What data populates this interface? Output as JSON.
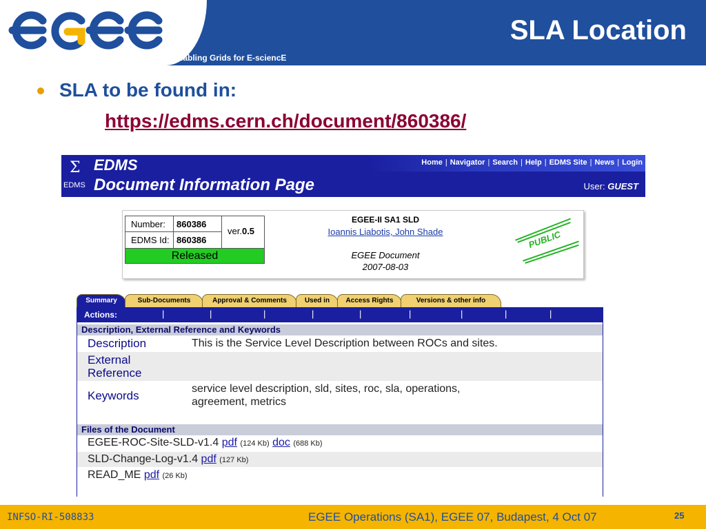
{
  "slide": {
    "tagline": "Enabling Grids for E-sciencE",
    "title": "SLA Location",
    "bullet_text": "SLA to be found in:",
    "bullet_link": "https://edms.cern.ch/document/860386/"
  },
  "edms": {
    "sigma": "Σ",
    "small_label": "EDMS",
    "title": "EDMS",
    "page_title": "Document Information Page",
    "nav": [
      "Home",
      "Navigator",
      "Search",
      "Help",
      "EDMS Site",
      "News",
      "Login"
    ],
    "nav_sep": "|",
    "user_label": "User:",
    "user_name": "GUEST",
    "number_label": "Number:",
    "number_value": "860386",
    "edmsid_label": "EDMS Id:",
    "edmsid_value": "860386",
    "ver_label": "ver.",
    "ver_value": "0.5",
    "status": "Released",
    "doc_title": "EGEE-II SA1 SLD",
    "doc_authors": "Ioannis Liabotis, John Shade",
    "doc_type": "EGEE Document",
    "doc_date": "2007-08-03",
    "stamp": "PUBLIC",
    "tabs": [
      "Summary",
      "Sub-Documents",
      "Approval & Comments",
      "Used in",
      "Access Rights",
      "Versions & other info"
    ],
    "actions_label": "Actions:",
    "section_desc": "Description, External Reference and Keywords",
    "desc_key": "Description",
    "desc_value": "This is the Service Level Description between ROCs and sites.",
    "extref_key": "External\nReference",
    "keywords_key": "Keywords",
    "keywords_value": "service level description, sld, sites, roc, sla, operations,\nagreement, metrics",
    "section_files": "Files of the Document",
    "files": [
      {
        "name": "EGEE-ROC-Site-SLD-v1.4",
        "link1": "pdf",
        "size1": "(124 Kb)",
        "link2": "doc",
        "size2": "(688 Kb)"
      },
      {
        "name": "SLD-Change-Log-v1.4",
        "link1": "pdf",
        "size1": "(127 Kb)"
      },
      {
        "name": "READ_ME",
        "link1": "pdf",
        "size1": "(26 Kb)"
      }
    ]
  },
  "footer": {
    "left": "INFSO-RI-508833",
    "center": "EGEE Operations (SA1), EGEE 07, Budapest, 4 Oct 07",
    "page": "25"
  },
  "colors": {
    "brand_blue": "#1f4f9d",
    "footer_gold": "#f5b400",
    "edms_blue": "#1a1fa0",
    "link_maroon": "#8b0033",
    "released_green": "#22cc22"
  }
}
